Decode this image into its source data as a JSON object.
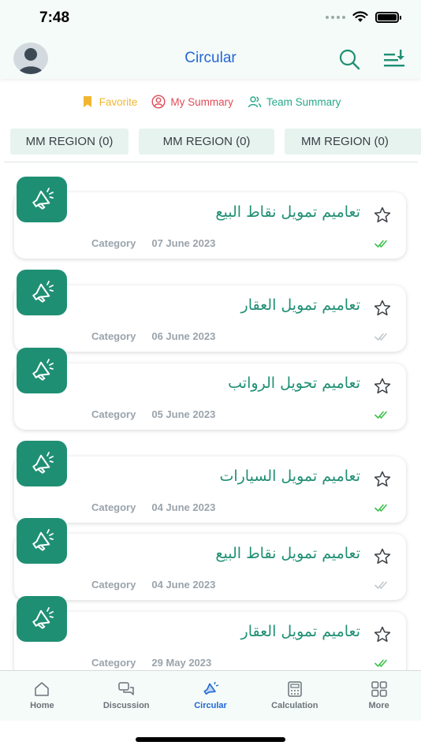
{
  "status_bar": {
    "time": "7:48",
    "signal_icon": "signal-dots-icon",
    "wifi_icon": "wifi-icon",
    "battery_icon": "battery-icon"
  },
  "header": {
    "title": "Circular",
    "avatar_icon": "user-avatar-icon",
    "search_icon": "search-icon",
    "sort_icon": "sort-download-icon"
  },
  "summary_tabs": [
    {
      "label": "Favorite",
      "icon": "bookmark-icon",
      "color": "#f2b632"
    },
    {
      "label": "My Summary",
      "icon": "person-circle-icon",
      "color": "#e04b56"
    },
    {
      "label": "Team Summary",
      "icon": "team-icon",
      "color": "#27a889"
    }
  ],
  "regions": [
    "MM REGION (0)",
    "MM REGION (0)",
    "MM REGION (0)"
  ],
  "circulars": [
    {
      "title": "تعاميم تمويل نقاط البيع",
      "category": "Category",
      "date": "07 June 2023",
      "read": true
    },
    {
      "title": "تعاميم تمويل العقار",
      "category": "Category",
      "date": "06 June 2023",
      "read": false
    },
    {
      "title": "تعاميم تحويل الرواتب",
      "category": "Category",
      "date": "05 June 2023",
      "read": true
    },
    {
      "title": "تعاميم تمويل السيارات",
      "category": "Category",
      "date": "04 June 2023",
      "read": true
    },
    {
      "title": "تعاميم تمويل نقاط البيع",
      "category": "Category",
      "date": "04 June 2023",
      "read": false
    },
    {
      "title": "تعاميم تمويل العقار",
      "category": "Category",
      "date": "29 May 2023",
      "read": true
    }
  ],
  "tabbar": [
    {
      "label": "Home",
      "icon": "home-icon",
      "active": false
    },
    {
      "label": "Discussion",
      "icon": "chat-bubbles-icon",
      "active": false
    },
    {
      "label": "Circular",
      "icon": "megaphone-icon",
      "active": true
    },
    {
      "label": "Calculation",
      "icon": "calculator-icon",
      "active": false
    },
    {
      "label": "More",
      "icon": "grid-icon",
      "active": false
    }
  ],
  "colors": {
    "accent": "#1f8f74",
    "header_title": "#2266d6",
    "read_check": "#3cbf4a",
    "unread_check": "#c3c8cc"
  }
}
